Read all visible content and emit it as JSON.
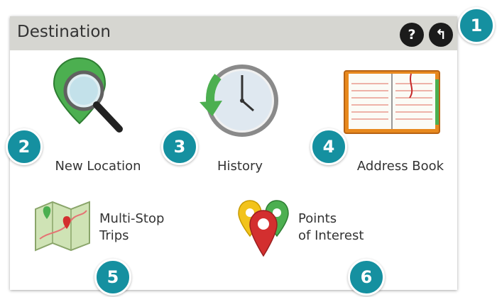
{
  "header": {
    "title": "Destination",
    "help_label": "?",
    "back_label": "↰"
  },
  "tiles": [
    {
      "label": "New Location",
      "icon": "magnifier-pin-icon"
    },
    {
      "label": "History",
      "icon": "clock-icon"
    },
    {
      "label": "Address Book",
      "icon": "address-book-icon"
    },
    {
      "label_line1": "Multi-Stop",
      "label_line2": "Trips",
      "icon": "map-icon"
    },
    {
      "label_line1": "Points",
      "label_line2": "of Interest",
      "icon": "poi-pins-icon"
    }
  ],
  "callouts": [
    "1",
    "2",
    "3",
    "4",
    "5",
    "6"
  ],
  "colors": {
    "header_bg": "#d6d6d1",
    "callout": "#1590a0",
    "pin_green": "#4caf50",
    "pin_red": "#d32f2f",
    "pin_yellow": "#f2c31b"
  }
}
